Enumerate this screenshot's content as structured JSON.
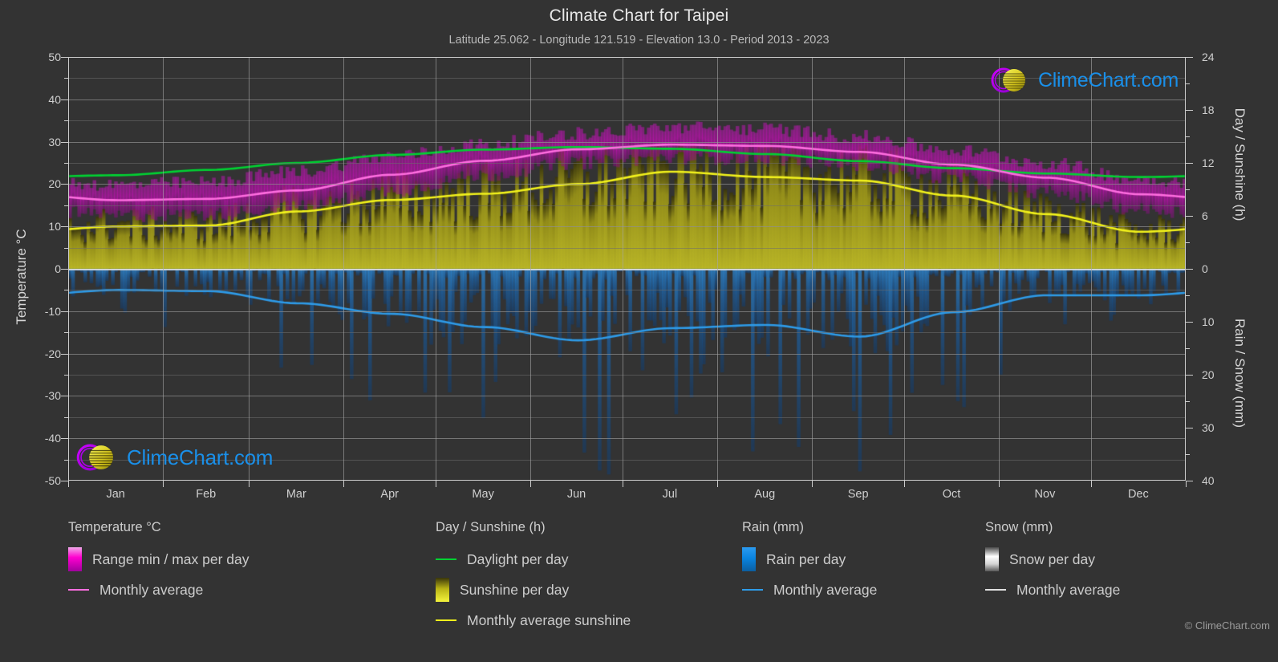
{
  "header": {
    "title": "Climate Chart for Taipei",
    "subtitle": "Latitude 25.062 - Longitude 121.519 - Elevation 13.0 - Period 2013 - 2023"
  },
  "branding": {
    "logo_text": "ClimeChart.com",
    "copyright": "© ClimeChart.com"
  },
  "axes": {
    "left_label": "Temperature °C",
    "right_label_top": "Day / Sunshine (h)",
    "right_label_bottom": "Rain / Snow (mm)",
    "left_ticks": [
      "50",
      "40",
      "30",
      "20",
      "10",
      "0",
      "-10",
      "-20",
      "-30",
      "-40",
      "-50"
    ],
    "right_ticks_top": [
      "24",
      "18",
      "12",
      "6",
      "0"
    ],
    "right_ticks_bottom": [
      "10",
      "20",
      "30",
      "40"
    ]
  },
  "legend": {
    "groups": [
      {
        "title": "Temperature °C",
        "items": [
          {
            "label": "Range min / max per day",
            "type": "swatch",
            "color": "#ff00d0"
          },
          {
            "label": "Monthly average",
            "type": "line",
            "color": "#ff6ee0"
          }
        ]
      },
      {
        "title": "Day / Sunshine (h)",
        "items": [
          {
            "label": "Daylight per day",
            "type": "line",
            "color": "#00d232"
          },
          {
            "label": "Sunshine per day",
            "type": "swatch",
            "color": "#eded1a"
          },
          {
            "label": "Monthly average sunshine",
            "type": "line",
            "color": "#f2f21c"
          }
        ]
      },
      {
        "title": "Rain (mm)",
        "items": [
          {
            "label": "Rain per day",
            "type": "swatch",
            "color": "#0a84e0"
          },
          {
            "label": "Monthly average",
            "type": "line",
            "color": "#2e9be8"
          }
        ]
      },
      {
        "title": "Snow (mm)",
        "items": [
          {
            "label": "Snow per day",
            "type": "swatch",
            "color": "#e8e8e8"
          },
          {
            "label": "Monthly average",
            "type": "line",
            "color": "#e0e0e0"
          }
        ]
      }
    ]
  },
  "chart_data": {
    "type": "area",
    "title": "Climate Chart for Taipei",
    "subtitle": "Latitude 25.062 - Longitude 121.519 - Elevation 13.0 - Period 2013 - 2023",
    "xlabel": "",
    "ylabel": "Temperature °C",
    "ylabel_right_top": "Day / Sunshine (h)",
    "ylabel_right_bottom": "Rain / Snow (mm)",
    "ylim": [
      -50,
      50
    ],
    "ylim_right_hours": [
      0,
      24
    ],
    "ylim_right_mm": [
      0,
      40
    ],
    "grid": true,
    "legend_position": "below",
    "categories": [
      "Jan",
      "Feb",
      "Mar",
      "Apr",
      "May",
      "Jun",
      "Jul",
      "Aug",
      "Sep",
      "Oct",
      "Nov",
      "Dec"
    ],
    "series": [
      {
        "name": "Monthly average temperature",
        "unit": "°C",
        "color": "#ff6ee0",
        "values": [
          16.2,
          16.5,
          18.5,
          22.2,
          25.5,
          28.2,
          29.3,
          29.0,
          27.6,
          24.6,
          21.5,
          17.6
        ]
      },
      {
        "name": "Daylight per day",
        "unit": "h",
        "color": "#00d232",
        "values": [
          10.6,
          11.2,
          12.0,
          12.9,
          13.5,
          13.8,
          13.6,
          13.0,
          12.2,
          11.4,
          10.8,
          10.4
        ]
      },
      {
        "name": "Monthly average sunshine",
        "unit": "h",
        "color": "#f2f21c",
        "values": [
          4.8,
          4.9,
          6.5,
          7.8,
          8.5,
          9.6,
          11.0,
          10.4,
          10.0,
          8.3,
          6.2,
          4.2
        ]
      },
      {
        "name": "Monthly average rain",
        "unit": "mm",
        "color": "#2e9be8",
        "values": [
          4.0,
          4.2,
          6.5,
          8.5,
          11.0,
          13.5,
          11.2,
          10.6,
          12.8,
          8.2,
          5.0,
          5.0
        ]
      },
      {
        "name": "Monthly average snow",
        "unit": "mm",
        "color": "#e0e0e0",
        "values": [
          0,
          0,
          0,
          0,
          0,
          0,
          0,
          0,
          0,
          0,
          0,
          0
        ]
      }
    ],
    "daily_ranges": {
      "name": "Range min / max per day",
      "unit": "°C",
      "color": "#ff00d0",
      "monthly_min": [
        12.5,
        12.8,
        14.6,
        18.4,
        22.0,
        25.0,
        26.2,
        26.0,
        24.6,
        21.4,
        18.0,
        14.0
      ],
      "monthly_max": [
        19.8,
        20.4,
        23.0,
        26.6,
        29.4,
        32.0,
        33.4,
        33.0,
        31.2,
        28.0,
        25.0,
        21.2
      ]
    }
  }
}
